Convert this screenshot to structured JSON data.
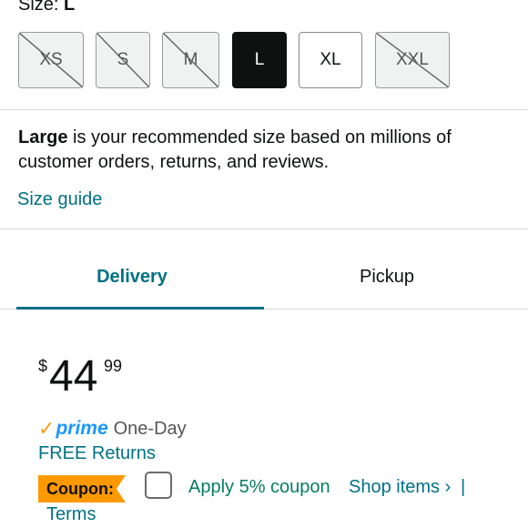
{
  "size_selector": {
    "label_prefix": "Size:",
    "selected_value": "L",
    "options": [
      {
        "label": "XS",
        "state": "unavailable"
      },
      {
        "label": "S",
        "state": "unavailable"
      },
      {
        "label": "M",
        "state": "unavailable"
      },
      {
        "label": "L",
        "state": "selected"
      },
      {
        "label": "XL",
        "state": "available"
      },
      {
        "label": "XXL",
        "state": "unavailable"
      }
    ]
  },
  "recommendation": {
    "bold": "Large",
    "text": " is your recommended size based on millions of customer orders, returns, and reviews."
  },
  "size_guide_link": "Size guide",
  "tabs": [
    {
      "label": "Delivery",
      "active": true
    },
    {
      "label": "Pickup",
      "active": false
    }
  ],
  "price": {
    "symbol": "$",
    "whole": "44",
    "fraction": "99"
  },
  "shipping": {
    "check": "✓",
    "prime": "prime",
    "speed": "One-Day",
    "returns": "FREE Returns"
  },
  "coupon": {
    "badge": "Coupon:",
    "apply_text": "Apply 5% coupon",
    "shop_items": "Shop items ›",
    "separator": "|",
    "terms": "Terms"
  },
  "colors": {
    "link": "#007185",
    "coupon_green": "#067d62",
    "badge_orange": "#ff9900",
    "prime_blue": "#1a98ff",
    "check_orange": "#f89d1b"
  }
}
